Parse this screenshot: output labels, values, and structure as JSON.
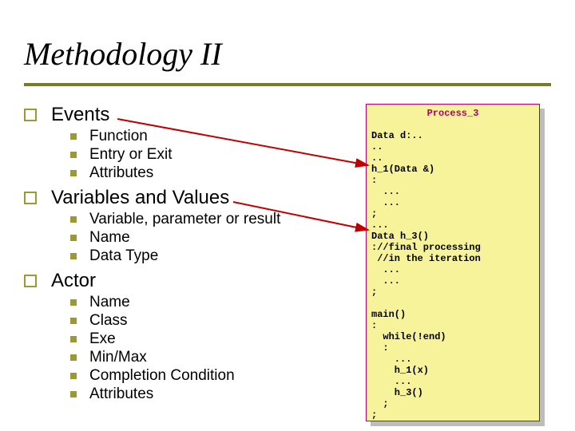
{
  "title": "Methodology II",
  "sections": [
    {
      "heading": "Events",
      "items": [
        "Function",
        "Entry or Exit",
        "Attributes"
      ]
    },
    {
      "heading": "Variables and Values",
      "items": [
        "Variable, parameter or result",
        "Name",
        "Data Type"
      ]
    },
    {
      "heading": "Actor",
      "items": [
        "Name",
        "Class",
        "Exe",
        "Min/Max",
        "Completion Condition",
        "Attributes"
      ]
    }
  ],
  "code": {
    "header": "Process_3",
    "body": "\nData d:..\n..\n..\nh_1(Data &)\n:\n  ...\n  ...\n;\n...\nData h_3()\n://final processing\n //in the iteration\n  ...\n  ...\n;\n\nmain()\n:\n  while(!end)\n  :\n    ...\n    h_1(x)\n    ...\n    h_3()\n  ;\n;"
  }
}
